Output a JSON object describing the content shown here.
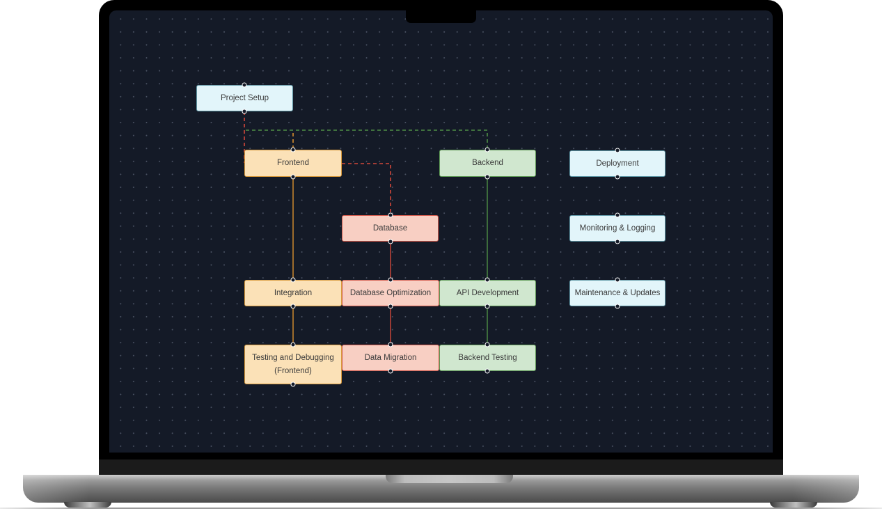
{
  "diagram": {
    "colors": {
      "canvas": "#141a27",
      "blue_fill": "#e2f5fa",
      "orange_fill": "#fbe1b7",
      "red_fill": "#f8cfc3",
      "green_fill": "#d0e7cf",
      "orange_edge": "#d9902e",
      "red_edge": "#d2483a",
      "green_edge": "#4f8f46"
    },
    "nodes": [
      {
        "id": "project-setup",
        "label": "Project Setup",
        "color": "blue"
      },
      {
        "id": "frontend",
        "label": "Frontend",
        "color": "orange"
      },
      {
        "id": "backend",
        "label": "Backend",
        "color": "green"
      },
      {
        "id": "deployment",
        "label": "Deployment",
        "color": "blue"
      },
      {
        "id": "database",
        "label": "Database",
        "color": "red"
      },
      {
        "id": "monitoring-logging",
        "label": "Monitoring & Logging",
        "color": "blue"
      },
      {
        "id": "integration",
        "label": "Integration",
        "color": "orange"
      },
      {
        "id": "database-optimization",
        "label": "Database Optimization",
        "color": "red"
      },
      {
        "id": "api-development",
        "label": "API Development",
        "color": "green"
      },
      {
        "id": "maintenance-updates",
        "label": "Maintenance & Updates",
        "color": "blue"
      },
      {
        "id": "testing-debugging-frontend",
        "label": "Testing and Debugging (Frontend)",
        "color": "orange"
      },
      {
        "id": "data-migration",
        "label": "Data Migration",
        "color": "red"
      },
      {
        "id": "backend-testing",
        "label": "Backend Testing",
        "color": "green"
      }
    ],
    "edges": [
      {
        "from": "project-setup",
        "to": "frontend",
        "style": "dashed",
        "color": "red"
      },
      {
        "from": "project-setup",
        "to": "backend",
        "style": "dashed",
        "color": "green"
      },
      {
        "from": "project-setup",
        "to": "frontend",
        "style": "dashed",
        "color": "orange"
      },
      {
        "from": "frontend",
        "to": "database",
        "style": "dashed",
        "color": "red"
      },
      {
        "from": "frontend",
        "to": "integration",
        "style": "solid",
        "color": "orange"
      },
      {
        "from": "integration",
        "to": "testing-debugging-frontend",
        "style": "solid",
        "color": "orange"
      },
      {
        "from": "database",
        "to": "database-optimization",
        "style": "solid",
        "color": "red"
      },
      {
        "from": "database-optimization",
        "to": "data-migration",
        "style": "solid",
        "color": "red"
      },
      {
        "from": "backend",
        "to": "api-development",
        "style": "solid",
        "color": "green"
      },
      {
        "from": "api-development",
        "to": "backend-testing",
        "style": "solid",
        "color": "green"
      }
    ]
  }
}
